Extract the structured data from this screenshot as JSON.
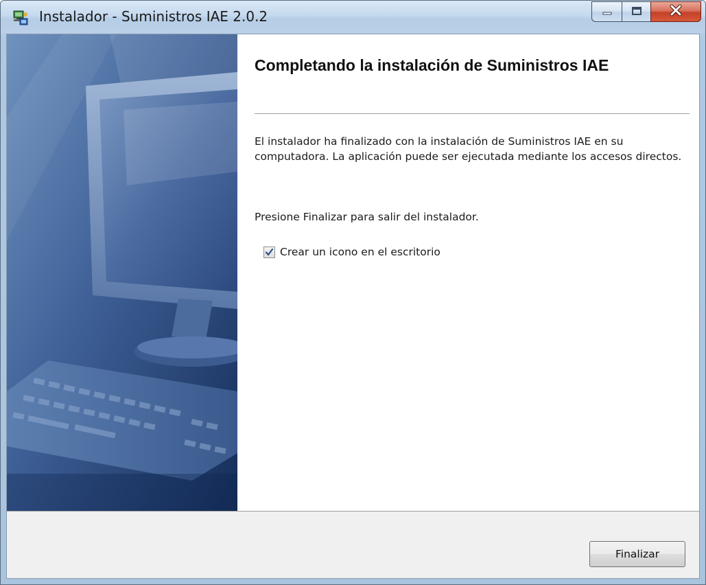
{
  "window": {
    "title": "Instalador - Suministros IAE 2.0.2",
    "icon": "installer-icon"
  },
  "caption_buttons": {
    "minimize_icon": "minimize-icon",
    "maximize_icon": "maximize-icon",
    "close_icon": "close-icon"
  },
  "sidebar": {
    "image": "computer-monitor-keyboard-illustration"
  },
  "main": {
    "heading": "Completando la instalación de Suministros IAE",
    "paragraph1": "El instalador ha finalizado con la instalación de Suministros IAE en su computadora. La aplicación puede ser ejecutada mediante los accesos directos.",
    "paragraph2": "Presione Finalizar para salir del instalador.",
    "checkbox": {
      "label": "Crear un icono en el escritorio",
      "checked": true
    }
  },
  "footer": {
    "finish_label": "Finalizar"
  },
  "colors": {
    "titlebar": "#c5d9ee",
    "close_button": "#c44128",
    "sidebar_dark": "#18325f",
    "footer_bg": "#f0f0f0"
  }
}
